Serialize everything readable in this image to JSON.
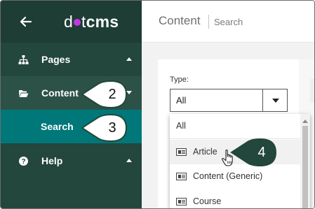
{
  "sidebar": {
    "logo": {
      "prefix": "d",
      "suffix": "t",
      "brand": "cms"
    },
    "items": [
      {
        "label": "Pages",
        "icon": "sitemap-icon"
      },
      {
        "label": "Content",
        "icon": "folder-open-icon"
      },
      {
        "label": "Search"
      },
      {
        "label": "Help",
        "icon": "question-circle-icon"
      }
    ]
  },
  "header": {
    "title": "Content",
    "breadcrumb": "Search"
  },
  "filter": {
    "type_label": "Type:",
    "selected": "All",
    "options": [
      "All",
      "Article",
      "Content (Generic)",
      "Course"
    ]
  },
  "callouts": [
    "2",
    "3",
    "4"
  ],
  "colors": {
    "sidebar_bg": "#23463d",
    "sidebar_header": "#1d3d35",
    "content_active": "#2c5247",
    "search_active": "#00787a",
    "logo_dot": "#c336e5",
    "callout_fill": "#ffffff",
    "callout_stroke": "#23463d"
  }
}
